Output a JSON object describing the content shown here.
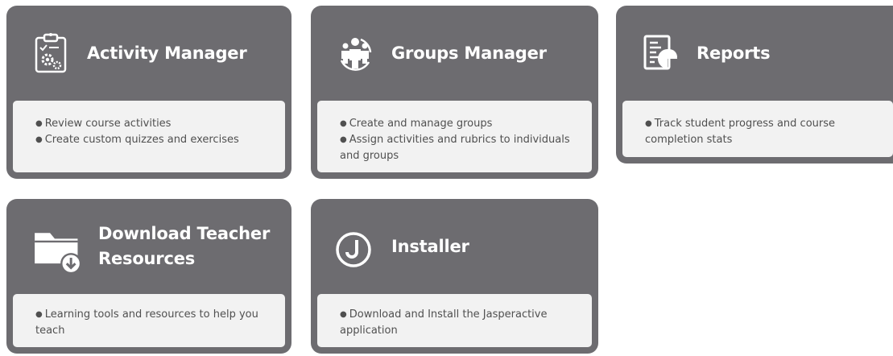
{
  "tiles": [
    {
      "title": "Activity Manager",
      "icon": "clipboard-gears-icon",
      "lines": [
        "Review course activities",
        "Create custom quizzes and exercises"
      ]
    },
    {
      "title": "Groups Manager",
      "icon": "people-group-icon",
      "lines": [
        "Create and manage groups",
        "Assign activities and rubrics to individuals and groups"
      ]
    },
    {
      "title": "Reports",
      "icon": "report-chart-icon",
      "lines": [
        "Track student progress and course completion stats"
      ]
    },
    {
      "title": "Download Teacher Resources",
      "icon": "folder-download-icon",
      "lines": [
        "Learning tools and resources to help you teach"
      ]
    },
    {
      "title": "Installer",
      "icon": "j-circle-icon",
      "lines": [
        "Download and Install the Jasperactive application"
      ]
    }
  ],
  "colors": {
    "tile_bg": "#6d6c70",
    "panel_bg": "#f2f2f2",
    "title": "#ffffff",
    "body_text": "#505050"
  }
}
